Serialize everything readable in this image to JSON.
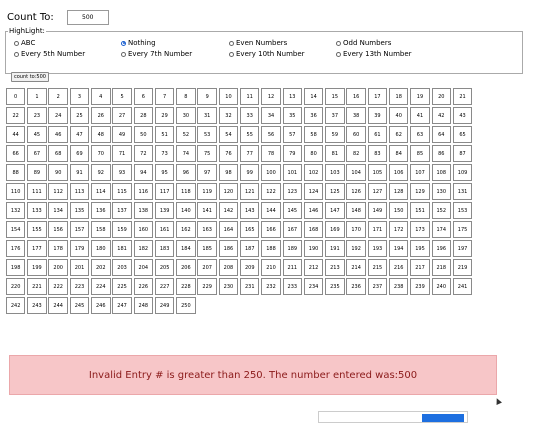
{
  "count": {
    "label": "Count To:",
    "value": "500"
  },
  "highlight": {
    "legend": "HighLight:",
    "options": [
      {
        "label": "ABC",
        "selected": false
      },
      {
        "label": "Nothing",
        "selected": true
      },
      {
        "label": "Even Numbers",
        "selected": false
      },
      {
        "label": "Odd Numbers",
        "selected": false
      },
      {
        "label": "Every 5th Number",
        "selected": false
      },
      {
        "label": "Every 7th Number",
        "selected": false
      },
      {
        "label": "Every 10th Number",
        "selected": false
      },
      {
        "label": "Every 13th Number",
        "selected": false
      }
    ],
    "button_label": "count to:500"
  },
  "grid": {
    "start": 0,
    "end": 250
  },
  "alert": {
    "message": "Invalid Entry # is greater than 250. The number entered was:500",
    "color_bg": "#f7c6c8",
    "color_text": "#8b1a1a"
  }
}
